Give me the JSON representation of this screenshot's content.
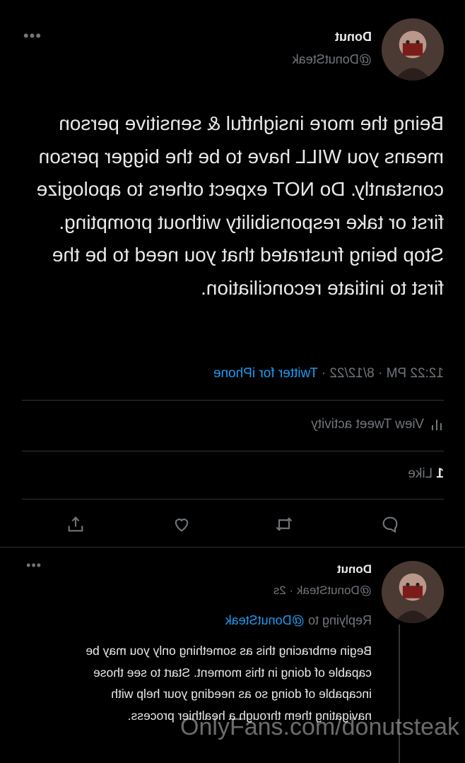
{
  "tweet": {
    "author": {
      "name": "Donut",
      "handle": "@DonutSteak"
    },
    "text": "Being the more insightful & sensitive person means you WILL have to be the bigger person constantly. Do NOT expect others to apologize first or take responsibility without prompting. Stop being frustrated that you need to be the first to initiate reconciliation.",
    "time": "12:22 PM",
    "date": "8/12/22",
    "source": "Twitter for iPhone",
    "separator": "·",
    "view_activity_label": "View Tweet activity",
    "like_count": "1",
    "like_label": "Like"
  },
  "reply": {
    "author": {
      "name": "Donut",
      "handle_time": "@DonutSteak · 2s"
    },
    "replying_prefix": "Replying to",
    "replying_to": "@DonutSteak",
    "text": "Begin embracing this as something only you may be capable of doing in this moment. Start to see those incapable of doing so as needing your help with navigating them through a healthier process."
  },
  "watermark": "OnlyFans.com/donutsteak",
  "icons": [
    "more-icon",
    "chart-icon",
    "reply-icon",
    "retweet-icon",
    "like-icon",
    "share-icon"
  ],
  "colors": {
    "background": "#000000",
    "text": "#e7e9ea",
    "muted": "#71767b",
    "link": "#1d9bf0",
    "divider": "#2f3336"
  }
}
